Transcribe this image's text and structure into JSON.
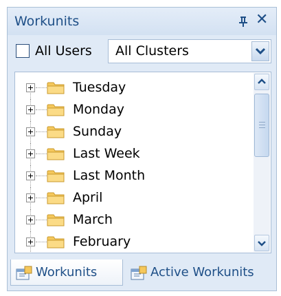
{
  "panel": {
    "title": "Workunits",
    "pin_icon": "pin-icon",
    "close_icon": "close-icon",
    "close_glyph": "✕"
  },
  "filter": {
    "all_users_label": "All Users",
    "all_users_checked": false,
    "cluster_value": "All Clusters",
    "dropdown_icon": "chevron-down-icon"
  },
  "tree": {
    "items": [
      {
        "label": "Tuesday",
        "icon": "folder-icon"
      },
      {
        "label": "Monday",
        "icon": "folder-icon"
      },
      {
        "label": "Sunday",
        "icon": "folder-icon"
      },
      {
        "label": "Last Week",
        "icon": "folder-icon"
      },
      {
        "label": "Last Month",
        "icon": "folder-icon"
      },
      {
        "label": "April",
        "icon": "folder-icon"
      },
      {
        "label": "March",
        "icon": "folder-icon"
      },
      {
        "label": "February",
        "icon": "folder-icon"
      }
    ]
  },
  "tabs": [
    {
      "label": "Workunits",
      "active": true,
      "icon": "workunit-icon"
    },
    {
      "label": "Active Workunits",
      "active": false,
      "icon": "workunit-icon"
    }
  ],
  "colors": {
    "accent": "#1e4f87",
    "panel_bg": "#e0eaf6",
    "folder": "#f5c85c"
  }
}
